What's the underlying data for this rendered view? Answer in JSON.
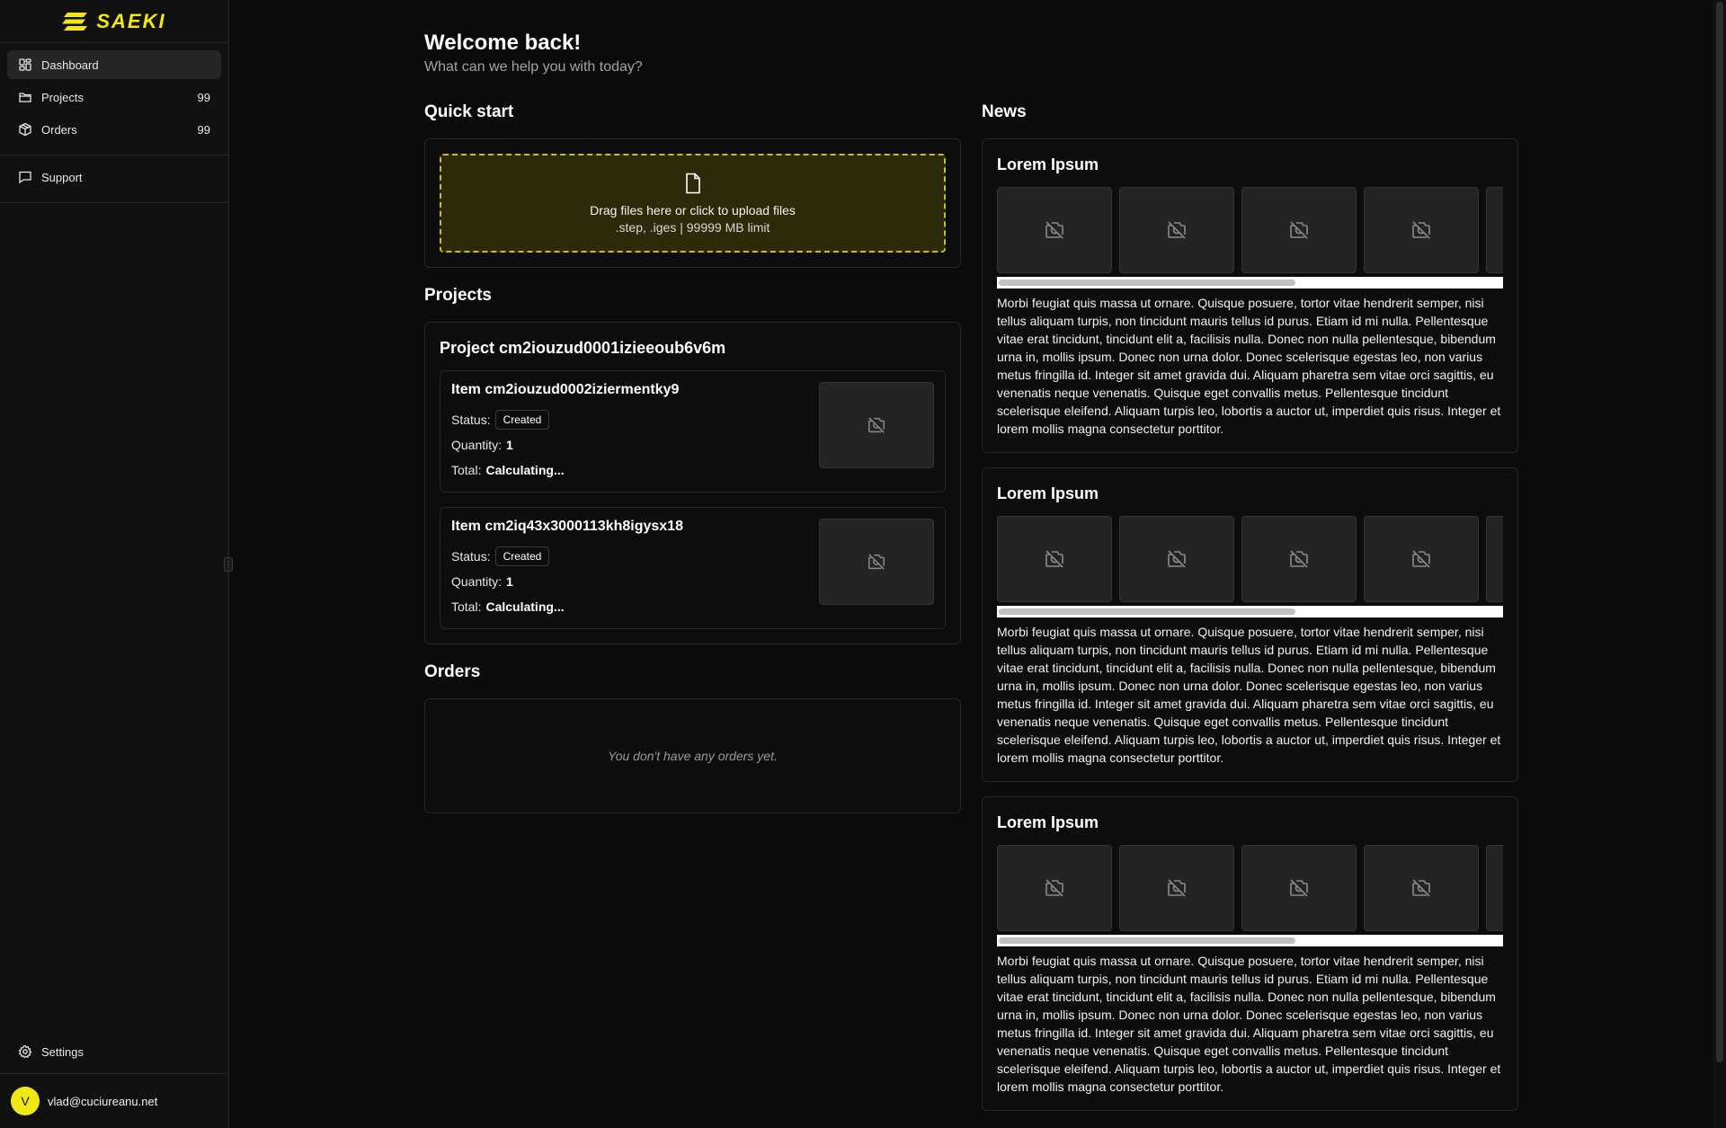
{
  "brand": {
    "name": "SAEKI",
    "color": "#f0e814"
  },
  "sidebar": {
    "items": [
      {
        "label": "Dashboard",
        "icon": "dashboard-icon",
        "count": ""
      },
      {
        "label": "Projects",
        "icon": "folder-icon",
        "count": "99"
      },
      {
        "label": "Orders",
        "icon": "package-icon",
        "count": "99"
      }
    ],
    "support": {
      "label": "Support",
      "icon": "message-square-icon"
    },
    "settings": {
      "label": "Settings",
      "icon": "gear-icon"
    },
    "user": {
      "initial": "V",
      "email": "vlad@cuciureanu.net"
    }
  },
  "header": {
    "title": "Welcome back!",
    "subtitle": "What can we help you with today?"
  },
  "quick_start": {
    "title": "Quick start",
    "upload_label": "Drag files here or click to upload files",
    "upload_hint": ".step, .iges | 99999 MB limit"
  },
  "projects": {
    "title": "Projects",
    "project_name": "Project cm2iouzud0001izieeoub6v6m",
    "items": [
      {
        "name": "Item cm2iouzud0002iziermentky9",
        "status_label": "Status:",
        "status": "Created",
        "quantity_label": "Quantity:",
        "quantity": "1",
        "total_label": "Total:",
        "total": "Calculating..."
      },
      {
        "name": "Item cm2iq43x3000113kh8igysx18",
        "status_label": "Status:",
        "status": "Created",
        "quantity_label": "Quantity:",
        "quantity": "1",
        "total_label": "Total:",
        "total": "Calculating..."
      }
    ]
  },
  "orders": {
    "title": "Orders",
    "empty": "You don't have any orders yet."
  },
  "news": {
    "title": "News",
    "items": [
      {
        "title": "Lorem Ipsum",
        "body": "Morbi feugiat quis massa ut ornare. Quisque posuere, tortor vitae hendrerit semper, nisi tellus aliquam turpis, non tincidunt mauris tellus id purus. Etiam id mi nulla. Pellentesque vitae erat tincidunt, tincidunt elit a, facilisis nulla. Donec non nulla pellentesque, bibendum urna in, mollis ipsum. Donec non urna dolor. Donec scelerisque egestas leo, non varius metus fringilla id. Integer sit amet gravida dui. Aliquam pharetra sem vitae orci sagittis, eu venenatis neque venenatis. Quisque eget convallis metus. Pellentesque tincidunt scelerisque eleifend. Aliquam turpis leo, lobortis a auctor ut, imperdiet quis risus. Integer et lorem mollis magna consectetur porttitor."
      },
      {
        "title": "Lorem Ipsum",
        "body": "Morbi feugiat quis massa ut ornare. Quisque posuere, tortor vitae hendrerit semper, nisi tellus aliquam turpis, non tincidunt mauris tellus id purus. Etiam id mi nulla. Pellentesque vitae erat tincidunt, tincidunt elit a, facilisis nulla. Donec non nulla pellentesque, bibendum urna in, mollis ipsum. Donec non urna dolor. Donec scelerisque egestas leo, non varius metus fringilla id. Integer sit amet gravida dui. Aliquam pharetra sem vitae orci sagittis, eu venenatis neque venenatis. Quisque eget convallis metus. Pellentesque tincidunt scelerisque eleifend. Aliquam turpis leo, lobortis a auctor ut, imperdiet quis risus. Integer et lorem mollis magna consectetur porttitor."
      },
      {
        "title": "Lorem Ipsum",
        "body": "Morbi feugiat quis massa ut ornare. Quisque posuere, tortor vitae hendrerit semper, nisi tellus aliquam turpis, non tincidunt mauris tellus id purus. Etiam id mi nulla. Pellentesque vitae erat tincidunt, tincidunt elit a, facilisis nulla. Donec non nulla pellentesque, bibendum urna in, mollis ipsum. Donec non urna dolor. Donec scelerisque egestas leo, non varius metus fringilla id. Integer sit amet gravida dui. Aliquam pharetra sem vitae orci sagittis, eu venenatis neque venenatis. Quisque eget convallis metus. Pellentesque tincidunt scelerisque eleifend. Aliquam turpis leo, lobortis a auctor ut, imperdiet quis risus. Integer et lorem mollis magna consectetur porttitor."
      }
    ]
  }
}
